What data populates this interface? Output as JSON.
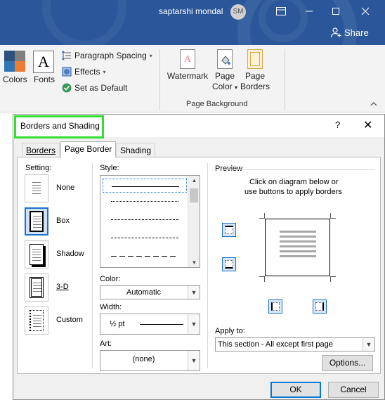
{
  "titlebar": {
    "user_name": "saptarshi mondal",
    "avatar_initials": "SM",
    "share_label": "Share",
    "bg_color": "#2b579a"
  },
  "ribbon": {
    "colors_label": "Colors",
    "fonts_label": "Fonts",
    "fonts_glyph": "A",
    "paragraph_spacing_label": "Paragraph Spacing",
    "effects_label": "Effects",
    "set_default_label": "Set as Default",
    "watermark_label": "Watermark",
    "page_color_label1": "Page",
    "page_color_label2": "Color",
    "page_borders_label1": "Page",
    "page_borders_label2": "Borders",
    "group_label": "Page Background"
  },
  "dialog": {
    "title": "Borders and Shading",
    "help": "?",
    "close": "✕",
    "tabs": [
      "Borders",
      "Page Border",
      "Shading"
    ],
    "active_tab": "Page Border",
    "setting_label": "Setting:",
    "settings": [
      "None",
      "Box",
      "Shadow",
      "3-D",
      "Custom"
    ],
    "selected_setting": "Box",
    "style_label": "Style:",
    "color_label": "Color:",
    "color_value": "Automatic",
    "width_label": "Width:",
    "width_value": "½ pt",
    "art_label": "Art:",
    "art_value": "(none)",
    "preview_label": "Preview",
    "preview_hint_line1": "Click on diagram below or",
    "preview_hint_line2": "use buttons to apply borders",
    "apply_to_label": "Apply to:",
    "apply_to_value": "This section - All except first page",
    "options_button": "Options...",
    "ok_button": "OK",
    "cancel_button": "Cancel",
    "highlight_color": "#32e032",
    "accent_color": "#1e6fcc"
  }
}
